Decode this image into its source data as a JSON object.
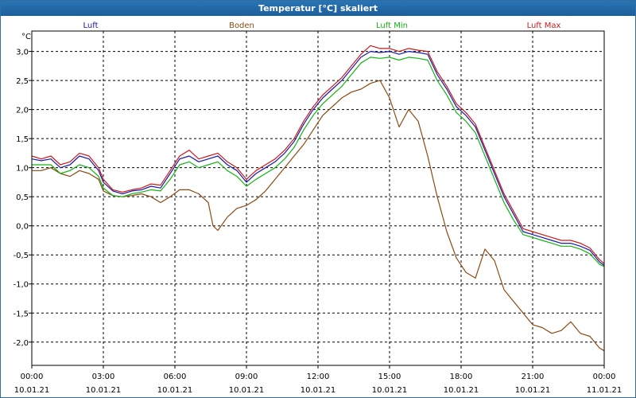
{
  "window": {
    "title": "Temperatur [°C] skaliert"
  },
  "chart_data": {
    "type": "line",
    "title": "Temperatur [°C] skaliert",
    "ylabel": "°C",
    "xlabel": "",
    "ylim": [
      -2.4,
      3.35
    ],
    "xlim": [
      0,
      24
    ],
    "grid": true,
    "legend_position": "top",
    "y_ticks": [
      3.0,
      2.5,
      2.0,
      1.5,
      1.0,
      0.5,
      0.0,
      -0.5,
      -1.0,
      -1.5,
      -2.0
    ],
    "y_tick_labels": [
      "3,0",
      "2,5",
      "2,0",
      "1,5",
      "1,0",
      "0,5",
      "0,0",
      "-0,5",
      "-1,0",
      "-1,5",
      "-2,0"
    ],
    "x_ticks": [
      {
        "x": 0,
        "time": "00:00",
        "date": "10.01.21"
      },
      {
        "x": 3,
        "time": "03:00",
        "date": "10.01.21"
      },
      {
        "x": 6,
        "time": "06:00",
        "date": "10.01.21"
      },
      {
        "x": 9,
        "time": "09:00",
        "date": "10.01.21"
      },
      {
        "x": 12,
        "time": "12:00",
        "date": "10.01.21"
      },
      {
        "x": 15,
        "time": "15:00",
        "date": "10.01.21"
      },
      {
        "x": 18,
        "time": "18:00",
        "date": "10.01.21"
      },
      {
        "x": 21,
        "time": "21:00",
        "date": "10.01.21"
      },
      {
        "x": 24,
        "time": "00:00",
        "date": "11.01.21"
      }
    ],
    "series": [
      {
        "name": "Luft",
        "color": "#1a1aa6",
        "points": [
          [
            0,
            1.15
          ],
          [
            0.4,
            1.12
          ],
          [
            0.8,
            1.15
          ],
          [
            1.2,
            1.0
          ],
          [
            1.6,
            1.05
          ],
          [
            2.0,
            1.2
          ],
          [
            2.4,
            1.15
          ],
          [
            2.8,
            0.95
          ],
          [
            3.0,
            0.75
          ],
          [
            3.4,
            0.6
          ],
          [
            3.8,
            0.55
          ],
          [
            4.2,
            0.6
          ],
          [
            4.6,
            0.62
          ],
          [
            5.0,
            0.68
          ],
          [
            5.4,
            0.65
          ],
          [
            5.8,
            0.9
          ],
          [
            6.2,
            1.15
          ],
          [
            6.6,
            1.2
          ],
          [
            7.0,
            1.1
          ],
          [
            7.4,
            1.15
          ],
          [
            7.8,
            1.2
          ],
          [
            8.2,
            1.05
          ],
          [
            8.6,
            0.95
          ],
          [
            9.0,
            0.75
          ],
          [
            9.4,
            0.9
          ],
          [
            9.8,
            1.0
          ],
          [
            10.2,
            1.1
          ],
          [
            10.6,
            1.25
          ],
          [
            11.0,
            1.45
          ],
          [
            11.4,
            1.75
          ],
          [
            11.8,
            2.0
          ],
          [
            12.2,
            2.2
          ],
          [
            12.6,
            2.35
          ],
          [
            13.0,
            2.5
          ],
          [
            13.4,
            2.7
          ],
          [
            13.8,
            2.9
          ],
          [
            14.2,
            3.0
          ],
          [
            14.6,
            2.98
          ],
          [
            15.0,
            3.0
          ],
          [
            15.4,
            2.95
          ],
          [
            15.8,
            3.0
          ],
          [
            16.2,
            2.98
          ],
          [
            16.6,
            2.95
          ],
          [
            17.0,
            2.6
          ],
          [
            17.4,
            2.35
          ],
          [
            17.8,
            2.05
          ],
          [
            18.2,
            1.9
          ],
          [
            18.6,
            1.7
          ],
          [
            19.0,
            1.3
          ],
          [
            19.4,
            0.9
          ],
          [
            19.8,
            0.5
          ],
          [
            20.2,
            0.2
          ],
          [
            20.6,
            -0.1
          ],
          [
            21.0,
            -0.15
          ],
          [
            21.4,
            -0.2
          ],
          [
            21.8,
            -0.25
          ],
          [
            22.2,
            -0.3
          ],
          [
            22.6,
            -0.3
          ],
          [
            23.0,
            -0.35
          ],
          [
            23.4,
            -0.42
          ],
          [
            23.8,
            -0.62
          ],
          [
            24.0,
            -0.68
          ]
        ]
      },
      {
        "name": "Boden",
        "color": "#8b4a12",
        "points": [
          [
            0,
            0.95
          ],
          [
            0.4,
            0.95
          ],
          [
            0.8,
            1.0
          ],
          [
            1.2,
            0.9
          ],
          [
            1.6,
            0.85
          ],
          [
            2.0,
            0.95
          ],
          [
            2.4,
            0.9
          ],
          [
            2.8,
            0.8
          ],
          [
            3.0,
            0.6
          ],
          [
            3.4,
            0.52
          ],
          [
            3.8,
            0.5
          ],
          [
            4.2,
            0.52
          ],
          [
            4.6,
            0.55
          ],
          [
            5.0,
            0.5
          ],
          [
            5.4,
            0.4
          ],
          [
            5.8,
            0.5
          ],
          [
            6.2,
            0.62
          ],
          [
            6.6,
            0.62
          ],
          [
            7.0,
            0.55
          ],
          [
            7.4,
            0.4
          ],
          [
            7.6,
            0.0
          ],
          [
            7.8,
            -0.08
          ],
          [
            8.2,
            0.15
          ],
          [
            8.6,
            0.3
          ],
          [
            9.0,
            0.35
          ],
          [
            9.4,
            0.45
          ],
          [
            9.8,
            0.6
          ],
          [
            10.2,
            0.8
          ],
          [
            10.6,
            1.0
          ],
          [
            11.0,
            1.2
          ],
          [
            11.4,
            1.4
          ],
          [
            11.8,
            1.65
          ],
          [
            12.2,
            1.9
          ],
          [
            12.6,
            2.05
          ],
          [
            13.0,
            2.2
          ],
          [
            13.4,
            2.3
          ],
          [
            13.8,
            2.35
          ],
          [
            14.2,
            2.45
          ],
          [
            14.6,
            2.5
          ],
          [
            15.0,
            2.2
          ],
          [
            15.4,
            1.7
          ],
          [
            15.8,
            2.0
          ],
          [
            16.2,
            1.8
          ],
          [
            16.6,
            1.2
          ],
          [
            17.0,
            0.5
          ],
          [
            17.4,
            -0.1
          ],
          [
            17.8,
            -0.55
          ],
          [
            18.2,
            -0.8
          ],
          [
            18.6,
            -0.9
          ],
          [
            19.0,
            -0.4
          ],
          [
            19.4,
            -0.6
          ],
          [
            19.8,
            -1.1
          ],
          [
            20.2,
            -1.3
          ],
          [
            20.6,
            -1.5
          ],
          [
            21.0,
            -1.7
          ],
          [
            21.4,
            -1.75
          ],
          [
            21.8,
            -1.85
          ],
          [
            22.2,
            -1.8
          ],
          [
            22.6,
            -1.65
          ],
          [
            23.0,
            -1.85
          ],
          [
            23.4,
            -1.9
          ],
          [
            23.8,
            -2.1
          ],
          [
            24.0,
            -2.15
          ]
        ]
      },
      {
        "name": "Luft Min",
        "color": "#13b313",
        "points": [
          [
            0,
            1.05
          ],
          [
            0.4,
            1.05
          ],
          [
            0.8,
            1.05
          ],
          [
            1.2,
            0.9
          ],
          [
            1.6,
            0.95
          ],
          [
            2.0,
            1.05
          ],
          [
            2.4,
            1.0
          ],
          [
            2.8,
            0.85
          ],
          [
            3.0,
            0.65
          ],
          [
            3.4,
            0.52
          ],
          [
            3.8,
            0.5
          ],
          [
            4.2,
            0.55
          ],
          [
            4.6,
            0.58
          ],
          [
            5.0,
            0.62
          ],
          [
            5.4,
            0.6
          ],
          [
            5.8,
            0.8
          ],
          [
            6.2,
            1.05
          ],
          [
            6.6,
            1.1
          ],
          [
            7.0,
            1.0
          ],
          [
            7.4,
            1.05
          ],
          [
            7.8,
            1.1
          ],
          [
            8.2,
            0.95
          ],
          [
            8.6,
            0.85
          ],
          [
            9.0,
            0.68
          ],
          [
            9.4,
            0.8
          ],
          [
            9.8,
            0.9
          ],
          [
            10.2,
            1.0
          ],
          [
            10.6,
            1.15
          ],
          [
            11.0,
            1.35
          ],
          [
            11.4,
            1.65
          ],
          [
            11.8,
            1.9
          ],
          [
            12.2,
            2.1
          ],
          [
            12.6,
            2.25
          ],
          [
            13.0,
            2.4
          ],
          [
            13.4,
            2.6
          ],
          [
            13.8,
            2.8
          ],
          [
            14.2,
            2.9
          ],
          [
            14.6,
            2.88
          ],
          [
            15.0,
            2.9
          ],
          [
            15.4,
            2.85
          ],
          [
            15.8,
            2.9
          ],
          [
            16.2,
            2.88
          ],
          [
            16.6,
            2.85
          ],
          [
            17.0,
            2.5
          ],
          [
            17.4,
            2.25
          ],
          [
            17.8,
            1.95
          ],
          [
            18.2,
            1.8
          ],
          [
            18.6,
            1.6
          ],
          [
            19.0,
            1.2
          ],
          [
            19.4,
            0.8
          ],
          [
            19.8,
            0.4
          ],
          [
            20.2,
            0.1
          ],
          [
            20.6,
            -0.15
          ],
          [
            21.0,
            -0.2
          ],
          [
            21.4,
            -0.25
          ],
          [
            21.8,
            -0.3
          ],
          [
            22.2,
            -0.35
          ],
          [
            22.6,
            -0.35
          ],
          [
            23.0,
            -0.4
          ],
          [
            23.4,
            -0.48
          ],
          [
            23.8,
            -0.66
          ],
          [
            24.0,
            -0.7
          ]
        ]
      },
      {
        "name": "Luft Max",
        "color": "#cc1a1a",
        "points": [
          [
            0,
            1.2
          ],
          [
            0.4,
            1.15
          ],
          [
            0.8,
            1.2
          ],
          [
            1.2,
            1.05
          ],
          [
            1.6,
            1.1
          ],
          [
            2.0,
            1.25
          ],
          [
            2.4,
            1.2
          ],
          [
            2.8,
            1.0
          ],
          [
            3.0,
            0.8
          ],
          [
            3.4,
            0.62
          ],
          [
            3.8,
            0.58
          ],
          [
            4.2,
            0.62
          ],
          [
            4.6,
            0.65
          ],
          [
            5.0,
            0.72
          ],
          [
            5.4,
            0.7
          ],
          [
            5.8,
            0.95
          ],
          [
            6.2,
            1.2
          ],
          [
            6.6,
            1.3
          ],
          [
            7.0,
            1.15
          ],
          [
            7.4,
            1.2
          ],
          [
            7.8,
            1.25
          ],
          [
            8.2,
            1.1
          ],
          [
            8.6,
            1.0
          ],
          [
            9.0,
            0.8
          ],
          [
            9.4,
            0.95
          ],
          [
            9.8,
            1.05
          ],
          [
            10.2,
            1.15
          ],
          [
            10.6,
            1.3
          ],
          [
            11.0,
            1.5
          ],
          [
            11.4,
            1.8
          ],
          [
            11.8,
            2.05
          ],
          [
            12.2,
            2.25
          ],
          [
            12.6,
            2.4
          ],
          [
            13.0,
            2.55
          ],
          [
            13.4,
            2.75
          ],
          [
            13.8,
            2.95
          ],
          [
            14.2,
            3.1
          ],
          [
            14.6,
            3.05
          ],
          [
            15.0,
            3.05
          ],
          [
            15.4,
            3.0
          ],
          [
            15.8,
            3.05
          ],
          [
            16.2,
            3.02
          ],
          [
            16.6,
            3.0
          ],
          [
            17.0,
            2.65
          ],
          [
            17.4,
            2.4
          ],
          [
            17.8,
            2.1
          ],
          [
            18.2,
            1.95
          ],
          [
            18.6,
            1.75
          ],
          [
            19.0,
            1.35
          ],
          [
            19.4,
            0.95
          ],
          [
            19.8,
            0.55
          ],
          [
            20.2,
            0.25
          ],
          [
            20.6,
            -0.05
          ],
          [
            21.0,
            -0.1
          ],
          [
            21.4,
            -0.15
          ],
          [
            21.8,
            -0.2
          ],
          [
            22.2,
            -0.25
          ],
          [
            22.6,
            -0.25
          ],
          [
            23.0,
            -0.3
          ],
          [
            23.4,
            -0.38
          ],
          [
            23.8,
            -0.58
          ],
          [
            24.0,
            -0.65
          ]
        ]
      }
    ]
  }
}
